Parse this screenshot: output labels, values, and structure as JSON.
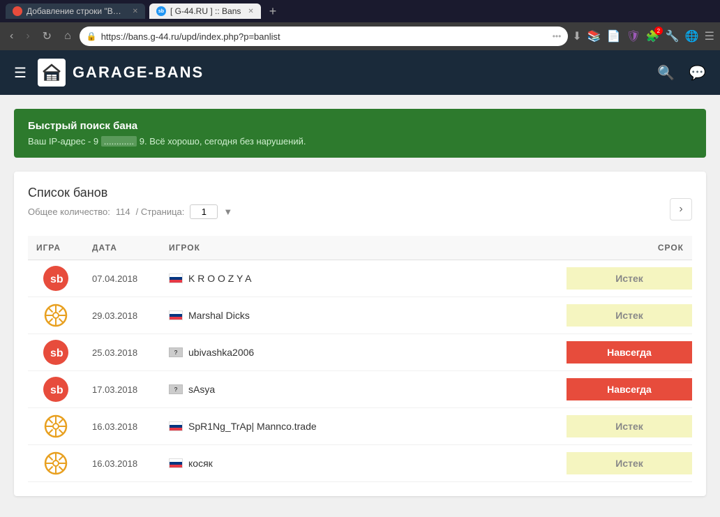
{
  "browser": {
    "tabs": [
      {
        "id": "tab1",
        "label": "Добавление строки \"Вы заба...",
        "active": false,
        "icon_type": "sb"
      },
      {
        "id": "tab2",
        "label": "[ G-44.RU ] :: Bans",
        "active": true,
        "icon_type": "g44"
      }
    ],
    "tab_add_label": "+",
    "nav": {
      "back_disabled": false,
      "forward_disabled": true,
      "url": "https://bans.g-44.ru/upd/index.php?p=banlist",
      "more_label": "•••"
    }
  },
  "header": {
    "menu_label": "☰",
    "logo_text": "GARAGE-BANS",
    "search_label": "🔍",
    "chat_label": "💬"
  },
  "ip_banner": {
    "title": "Быстрый поиск бана",
    "text_prefix": "Ваш IP-адрес - 9",
    "text_ip_hidden": "............",
    "text_ip_suffix": "9.",
    "text_status": " Всё хорошо, сегодня без нарушений."
  },
  "card": {
    "title": "Список банов",
    "total_label": "Общее количество:",
    "total_value": "114",
    "page_label": "/ Страница:",
    "page_value": "1",
    "columns": {
      "game": "ИГРА",
      "date": "ДАТА",
      "player": "ИГРОК",
      "duration": "СРОК"
    },
    "rows": [
      {
        "id": 1,
        "game_type": "sb",
        "date": "07.04.2018",
        "flag": "ru",
        "player": "K R O O Z Y A",
        "status": "Истек",
        "status_type": "expired"
      },
      {
        "id": 2,
        "game_type": "wheel",
        "date": "29.03.2018",
        "flag": "ru",
        "player": "Marshal Dicks",
        "status": "Истек",
        "status_type": "expired"
      },
      {
        "id": 3,
        "game_type": "sb",
        "date": "25.03.2018",
        "flag": "unknown",
        "player": "ubivashka2006",
        "status": "Навсегда",
        "status_type": "permanent"
      },
      {
        "id": 4,
        "game_type": "sb",
        "date": "17.03.2018",
        "flag": "unknown",
        "player": "sAsya",
        "status": "Навсегда",
        "status_type": "permanent"
      },
      {
        "id": 5,
        "game_type": "wheel",
        "date": "16.03.2018",
        "flag": "ru",
        "player": "SpR1Ng_TrAp| Mannco.trade",
        "status": "Истек",
        "status_type": "expired"
      },
      {
        "id": 6,
        "game_type": "wheel",
        "date": "16.03.2018",
        "flag": "ru",
        "player": "косяк",
        "status": "Истек",
        "status_type": "expired"
      }
    ],
    "nav_next_label": "›"
  }
}
